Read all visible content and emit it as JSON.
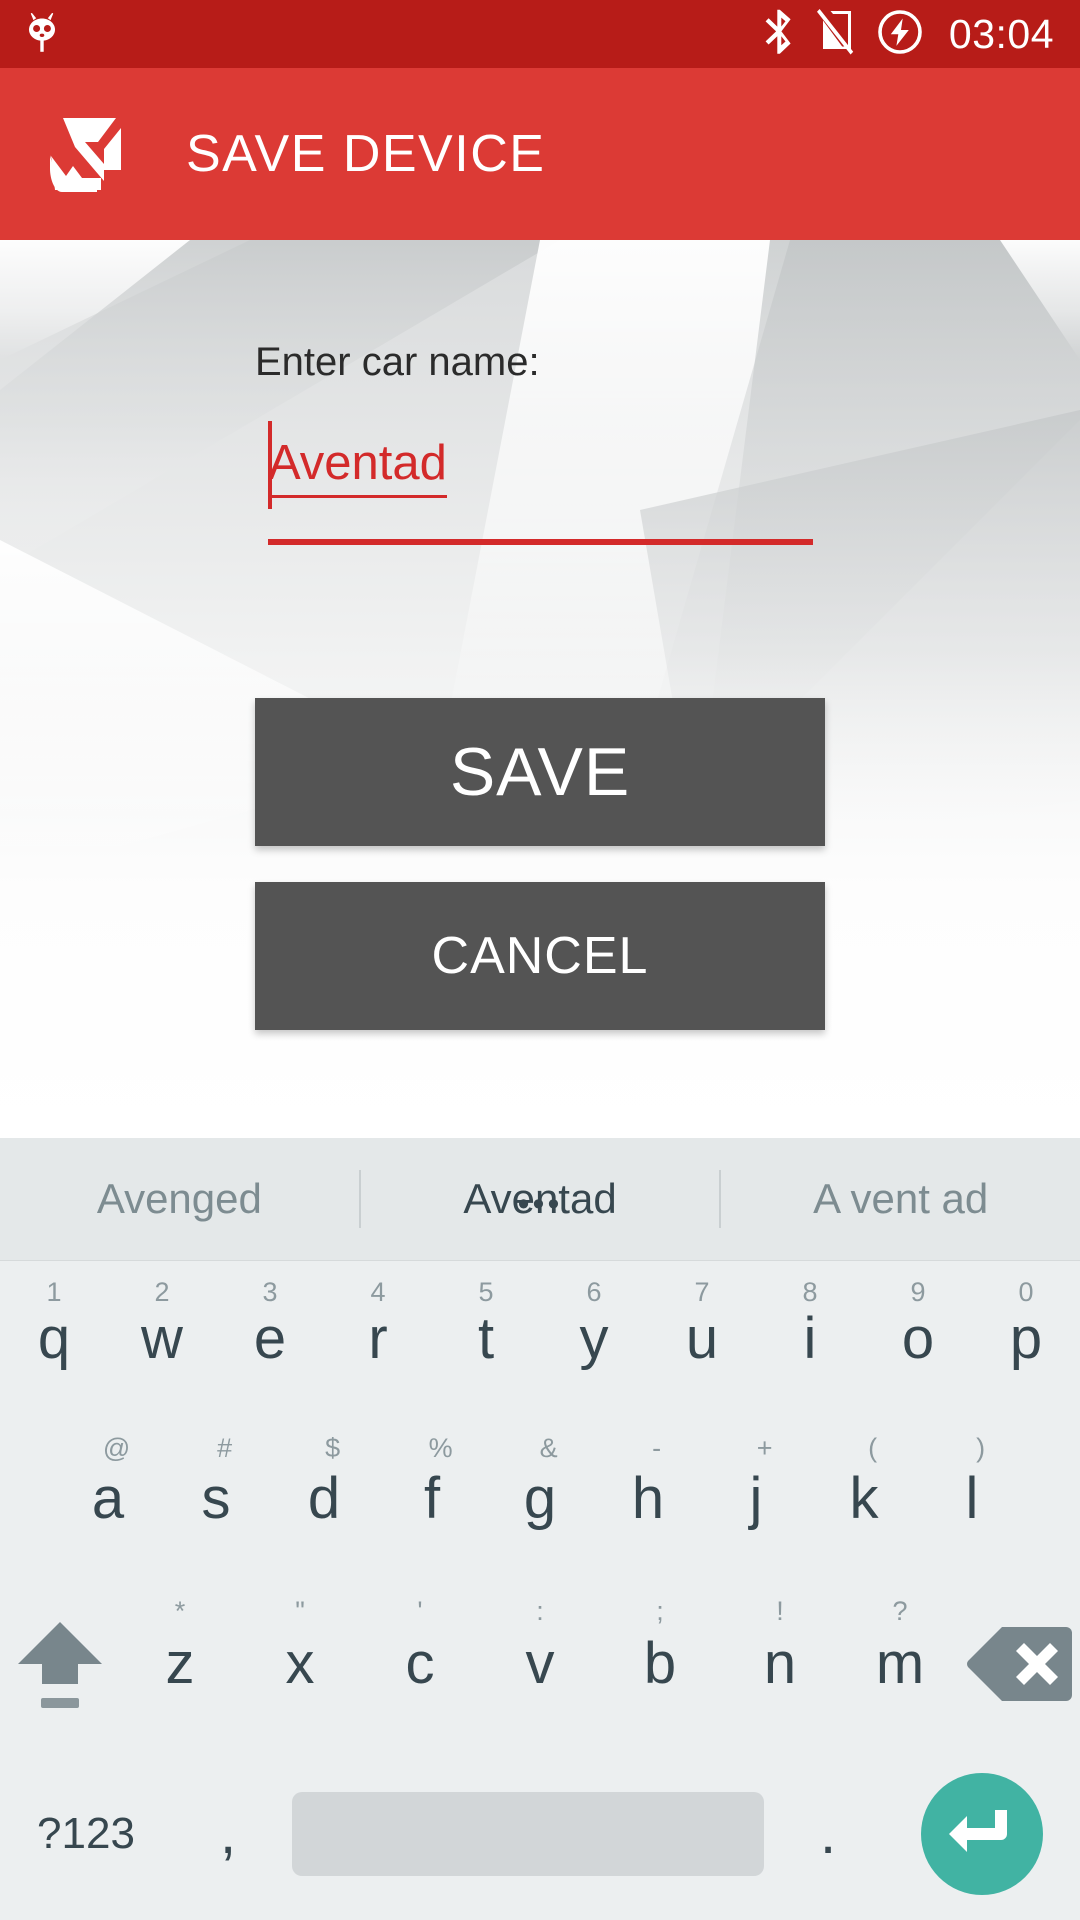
{
  "status_bar": {
    "background_color": "#b71c18",
    "left_icon": "cyanogenmod-logo-icon",
    "icons": [
      "bluetooth-icon",
      "no-sim-card-icon",
      "battery-charging-icon"
    ],
    "clock": "03:04"
  },
  "app_bar": {
    "background_color": "#dc3a35",
    "logo": "app-logo-icon",
    "title": "SAVE DEVICE"
  },
  "content": {
    "field_label": "Enter car name:",
    "name_input": {
      "value": "Aventad",
      "placeholder": "",
      "text_color": "#d32a2a"
    },
    "save_label": "SAVE",
    "cancel_label": "CANCEL",
    "button_color": "#545454"
  },
  "keyboard": {
    "suggestions": [
      {
        "text": "Avenged",
        "active": false
      },
      {
        "text": "Aventad",
        "active": true
      },
      {
        "text": "A vent ad",
        "active": false
      }
    ],
    "suggestion_more": "•••",
    "row1": [
      {
        "main": "q",
        "hint": "1"
      },
      {
        "main": "w",
        "hint": "2"
      },
      {
        "main": "e",
        "hint": "3"
      },
      {
        "main": "r",
        "hint": "4"
      },
      {
        "main": "t",
        "hint": "5"
      },
      {
        "main": "y",
        "hint": "6"
      },
      {
        "main": "u",
        "hint": "7"
      },
      {
        "main": "i",
        "hint": "8"
      },
      {
        "main": "o",
        "hint": "9"
      },
      {
        "main": "p",
        "hint": "0"
      }
    ],
    "row2": [
      {
        "main": "a",
        "hint": "@"
      },
      {
        "main": "s",
        "hint": "#"
      },
      {
        "main": "d",
        "hint": "$"
      },
      {
        "main": "f",
        "hint": "%"
      },
      {
        "main": "g",
        "hint": "&"
      },
      {
        "main": "h",
        "hint": "-"
      },
      {
        "main": "j",
        "hint": "+"
      },
      {
        "main": "k",
        "hint": "("
      },
      {
        "main": "l",
        "hint": ")"
      }
    ],
    "row3": [
      {
        "main": "z",
        "hint": "*"
      },
      {
        "main": "x",
        "hint": "\""
      },
      {
        "main": "c",
        "hint": "'"
      },
      {
        "main": "v",
        "hint": ":"
      },
      {
        "main": "b",
        "hint": ";"
      },
      {
        "main": "n",
        "hint": "!"
      },
      {
        "main": "m",
        "hint": "?"
      }
    ],
    "shift_key": "shift-icon",
    "backspace_key": "backspace-icon",
    "symbols_key": "?123",
    "comma_key": ",",
    "space_key": "space-bar",
    "period_key": ".",
    "enter_key": "enter-icon",
    "enter_color": "#41b3a3",
    "background_color": "#eceff0"
  }
}
